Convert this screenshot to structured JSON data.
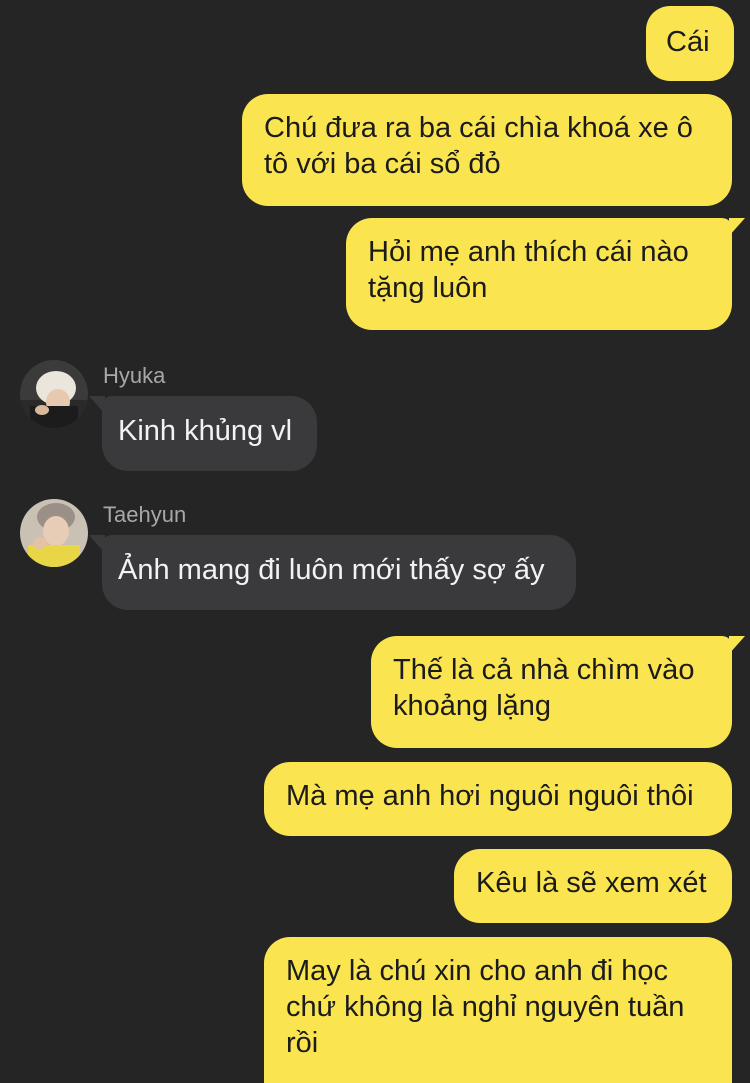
{
  "messages": [
    {
      "type": "outgoing",
      "text": "Cái"
    },
    {
      "type": "outgoing",
      "text": "Chú đưa ra ba cái chìa khoá xe ô\ntô với ba cái sổ đỏ"
    },
    {
      "type": "outgoing",
      "text": "Hỏi mẹ anh thích cái nào\ntặng luôn"
    },
    {
      "type": "incoming",
      "sender": "Hyuka",
      "text": "Kinh khủng vl"
    },
    {
      "type": "incoming",
      "sender": "Taehyun",
      "text": "Ảnh mang đi luôn mới thấy sợ ấy"
    },
    {
      "type": "outgoing",
      "text": "Thế là cả nhà chìm vào\nkhoảng lặng"
    },
    {
      "type": "outgoing",
      "text": "Mà mẹ anh hơi nguôi nguôi thôi"
    },
    {
      "type": "outgoing",
      "text": "Kêu là sẽ xem xét"
    },
    {
      "type": "outgoing",
      "text": "May là chú xin cho anh đi học\nchứ không là nghỉ nguyên tuần\nrồi"
    }
  ],
  "colors": {
    "background": "#252525",
    "outgoing_bubble": "#fae450",
    "incoming_bubble": "#3a3a3c",
    "sender_name": "#a8a8a8"
  }
}
